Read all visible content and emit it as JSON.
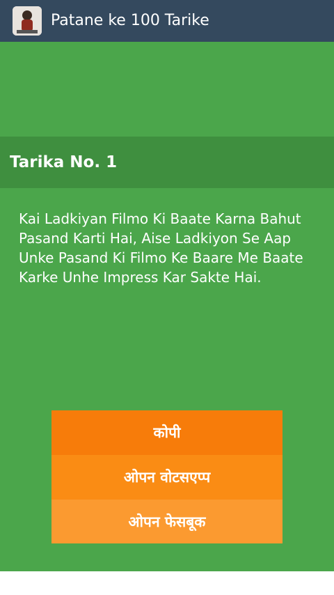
{
  "app": {
    "title": "Patane ke 100 Tarike"
  },
  "tarika": {
    "heading": "Tarika No. 1",
    "text": "Kai Ladkiyan Filmo Ki Baate Karna Bahut Pasand Karti Hai, Aise Ladkiyon Se Aap Unke Pasand Ki Filmo Ke Baare Me Baate Karke Unhe Impress Kar Sakte Hai."
  },
  "buttons": {
    "copy_label": "कोपी",
    "whatsapp_label": "ओपन वोटसएप्प",
    "facebook_label": "ओपन फेसबूक"
  },
  "colors": {
    "topbar": "#34495e",
    "background_green": "#4ba64b",
    "heading_bar": "#3f8f3f",
    "copy_button": "#f77c0a",
    "whatsapp_button": "#fa8c14",
    "facebook_button": "#fb9a30"
  },
  "icons": {
    "app_icon": "app-logo-icon"
  }
}
